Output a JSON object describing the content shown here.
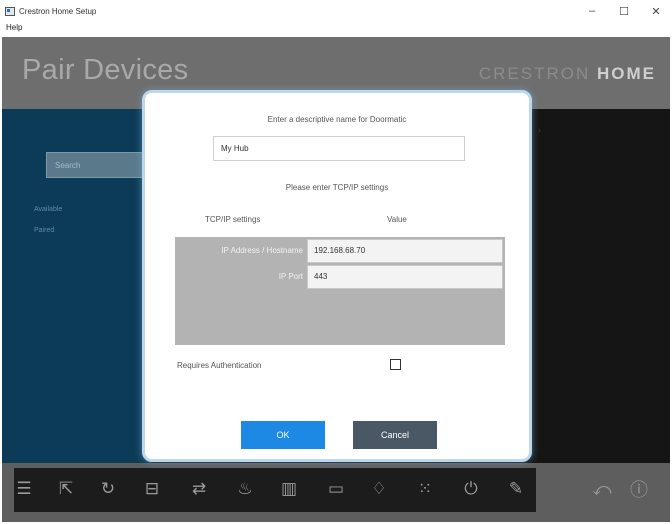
{
  "window": {
    "title": "Crestron Home Setup",
    "menu_help": "Help",
    "minimize": "–",
    "maximize": "☐",
    "close": "✕"
  },
  "header": {
    "page_title": "Pair Devices",
    "brand_light": "CRESTRON",
    "brand_strong": "HOME"
  },
  "left_panel": {
    "search_placeholder": "Search",
    "links": [
      "Available",
      "Paired"
    ]
  },
  "right_panel": {
    "mark": "›"
  },
  "modal": {
    "prompt_label": "Enter a descriptive name for Doormatic",
    "name_value": "My Hub",
    "tcp_heading": "Please enter TCP/IP settings",
    "col_left": "TCP/IP settings",
    "col_right": "Value",
    "rows": [
      {
        "label": "IP Address / Hostname",
        "value": "192.168.68.70"
      },
      {
        "label": "IP Port",
        "value": "443"
      }
    ],
    "auth_label": "Requires Authentication",
    "auth_checked": false,
    "ok_label": "OK",
    "cancel_label": "Cancel"
  },
  "toolbar": {
    "icons": [
      "menu-icon",
      "scene-icon",
      "power-link-icon",
      "room-icon",
      "swap-icon",
      "light-bulb-icon",
      "shade-icon",
      "display-icon",
      "thermostat-icon",
      "keypad-icon",
      "power-icon",
      "tools-icon"
    ],
    "right_icons": [
      "back-icon",
      "info-icon"
    ]
  },
  "colors": {
    "accent": "#1e88e5",
    "cancel": "#4a5866",
    "left_panel": "#0c3b57",
    "modal_border": "#bcd8ee"
  }
}
